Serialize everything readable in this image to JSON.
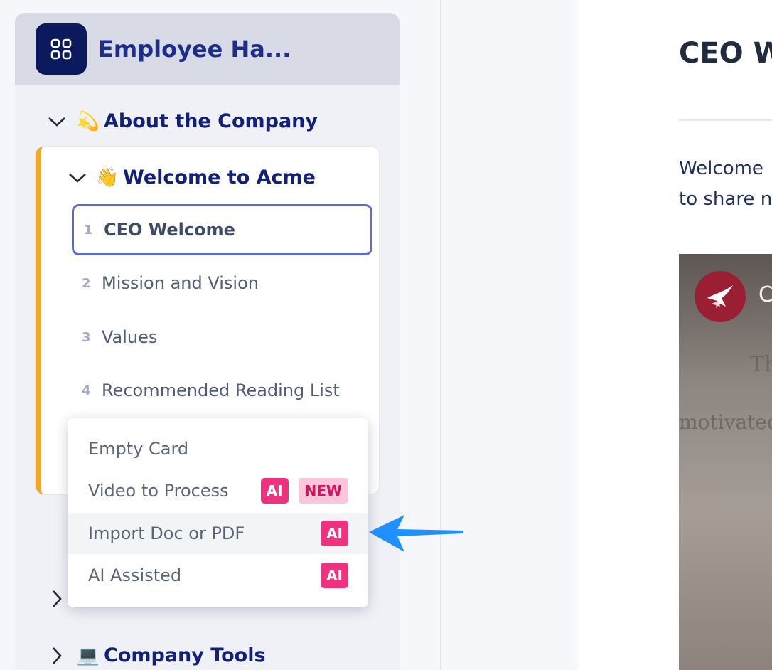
{
  "sidebar": {
    "app_title": "Employee Ha...",
    "app_icon": "grid-icon",
    "sections": [
      {
        "emoji": "💫",
        "label": "About the Company",
        "expanded": true
      },
      {
        "emoji": "💻",
        "label": "Company Tools",
        "expanded": false
      }
    ],
    "subsection": {
      "emoji": "👋",
      "label": "Welcome to Acme",
      "items": [
        {
          "num": "1",
          "label": "CEO Welcome"
        },
        {
          "num": "2",
          "label": "Mission and Vision"
        },
        {
          "num": "3",
          "label": "Values"
        },
        {
          "num": "4",
          "label": "Recommended Reading List"
        }
      ]
    }
  },
  "dropdown": {
    "items": [
      {
        "label": "Empty Card"
      },
      {
        "label": "Video to Process",
        "ai_badge": "AI",
        "new_badge": "NEW"
      },
      {
        "label": "Import Doc or PDF",
        "ai_badge": "AI"
      },
      {
        "label": "AI Assisted",
        "ai_badge": "AI"
      }
    ]
  },
  "content": {
    "title": "CEO W",
    "paragraph_line1": "Welcome",
    "paragraph_line2": "to share n",
    "video_channel_initial": "C",
    "video_text_1": "The",
    "video_text_2": "motivated pe"
  },
  "colors": {
    "accent": "#5b6ad8",
    "brand_navy": "#0a1a5c",
    "ai_badge": "#f0317f",
    "card_stripe": "#f5a623",
    "arrow": "#1e90ff"
  }
}
